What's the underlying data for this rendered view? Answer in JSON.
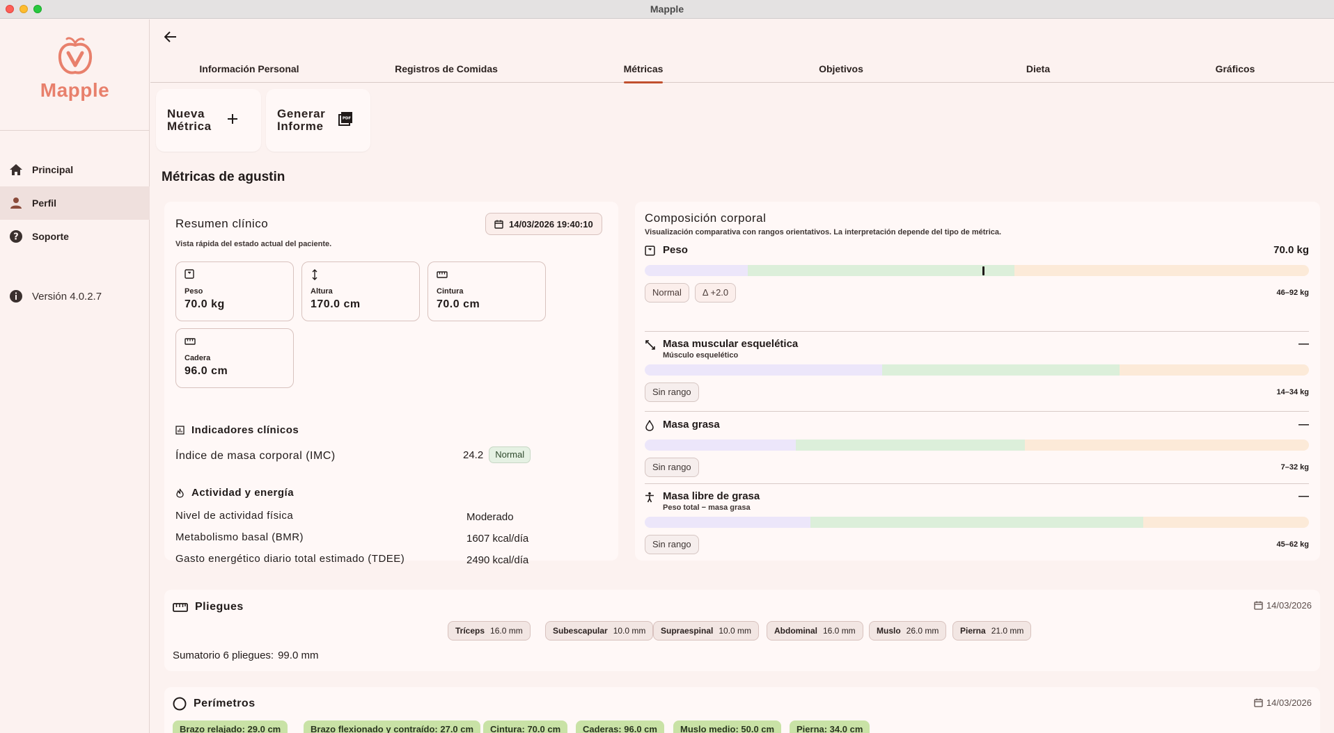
{
  "window": {
    "title": "Mapple"
  },
  "sidebar": {
    "logo_text": "Mapple",
    "items": [
      {
        "label": "Principal",
        "icon": "home-icon"
      },
      {
        "label": "Perfil",
        "icon": "person-icon",
        "active": true
      },
      {
        "label": "Soporte",
        "icon": "help-icon"
      }
    ],
    "version": "Versión 4.0.2.7"
  },
  "tabs": [
    {
      "label": "Información Personal"
    },
    {
      "label": "Registros de Comidas"
    },
    {
      "label": "Métricas",
      "active": true
    },
    {
      "label": "Objetivos"
    },
    {
      "label": "Dieta"
    },
    {
      "label": "Gráficos"
    }
  ],
  "actions": {
    "new_metric_line1": "Nueva",
    "new_metric_line2": "Métrica",
    "report_line1": "Generar",
    "report_line2": "Informe"
  },
  "page_title": "Métricas de agustin",
  "summary": {
    "title": "Resumen clínico",
    "subtitle": "Vista rápida del estado actual del paciente.",
    "date": "14/03/2026 19:40:10",
    "metrics": [
      {
        "label": "Peso",
        "value": "70.0 kg",
        "icon": "scale-icon"
      },
      {
        "label": "Altura",
        "value": "170.0 cm",
        "icon": "height-icon"
      },
      {
        "label": "Cintura",
        "value": "70.0 cm",
        "icon": "ruler-icon"
      },
      {
        "label": "Cadera",
        "value": "96.0 cm",
        "icon": "ruler-icon"
      }
    ],
    "indicators_title": "Indicadores clínicos",
    "imc_label": "Índice de masa corporal (IMC)",
    "imc_value": "24.2",
    "imc_badge": "Normal",
    "activity_title": "Actividad y energía",
    "activity_rows": [
      {
        "label": "Nivel de actividad física",
        "value": "Moderado"
      },
      {
        "label": "Metabolismo basal (BMR)",
        "value": "1607 kcal/día"
      },
      {
        "label": "Gasto energético diario total estimado (TDEE)",
        "value": "2490 kcal/día"
      }
    ]
  },
  "composition": {
    "title": "Composición corporal",
    "subtitle": "Visualización comparativa con rangos orientativos. La interpretación depende del tipo de métrica.",
    "rows": [
      {
        "name": "Peso",
        "sub": "",
        "value": "70.0 kg",
        "pills": [
          "Normal",
          "Δ +2.0"
        ],
        "range": "46–92 kg",
        "icon": "scale-icon",
        "marker_fraction": 0.51
      },
      {
        "name": "Masa muscular esquelética",
        "sub": "Músculo esquelético",
        "value": "—",
        "pills": [
          "Sin rango"
        ],
        "range": "14–34 kg",
        "icon": "expand-icon"
      },
      {
        "name": "Masa grasa",
        "sub": "",
        "value": "—",
        "pills": [
          "Sin rango"
        ],
        "range": "7–32 kg",
        "icon": "drop-icon"
      },
      {
        "name": "Masa libre de grasa",
        "sub": "Peso total − masa grasa",
        "value": "—",
        "pills": [
          "Sin rango"
        ],
        "range": "45–62 kg",
        "icon": "body-icon"
      }
    ]
  },
  "folds": {
    "title": "Pliegues",
    "date": "14/03/2026",
    "chips": [
      {
        "name": "Tríceps",
        "value": "16.0 mm"
      },
      {
        "name": "Subescapular",
        "value": "10.0 mm"
      },
      {
        "name": "Supraespinal",
        "value": "10.0 mm"
      },
      {
        "name": "Abdominal",
        "value": "16.0 mm"
      },
      {
        "name": "Muslo",
        "value": "26.0 mm"
      },
      {
        "name": "Pierna",
        "value": "21.0 mm"
      }
    ],
    "sum_label": "Sumatorio 6 pliegues:",
    "sum_value": "99.0 mm"
  },
  "perimeters": {
    "title": "Perímetros",
    "date": "14/03/2026",
    "chips": [
      "Brazo relajado: 29.0 cm",
      "Brazo flexionado y contraído: 27.0 cm",
      "Cintura: 70.0 cm",
      "Caderas: 96.0 cm",
      "Muslo medio: 50.0 cm",
      "Pierna: 34.0 cm"
    ]
  }
}
